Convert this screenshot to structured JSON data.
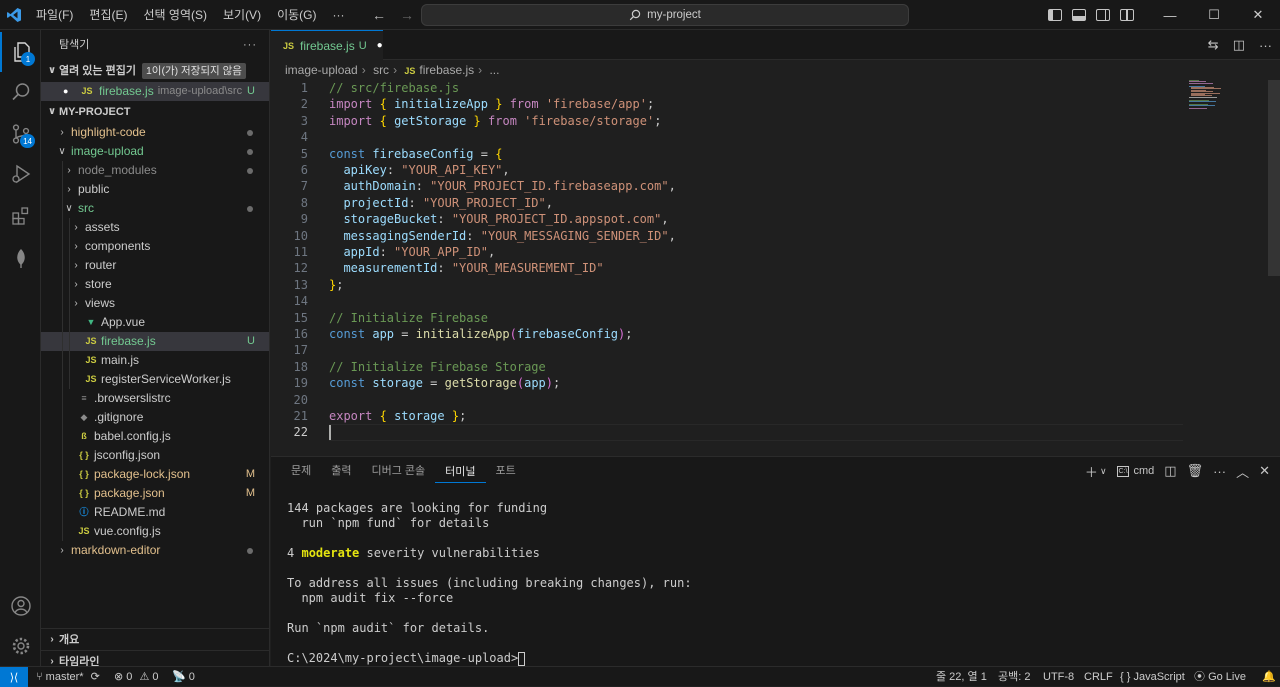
{
  "titlebar": {
    "menu": [
      "파일(F)",
      "편집(E)",
      "선택 영역(S)",
      "보기(V)",
      "이동(G)",
      "···"
    ],
    "search_text": "my-project"
  },
  "activity": {
    "explorer_badge": "1",
    "scm_badge": "14"
  },
  "sidebar": {
    "title": "탐색기",
    "open_editors_label": "열려 있는 편집기",
    "unsaved_tooltip": "1이(가) 저장되지 않음",
    "open_file_name": "firebase.js",
    "open_file_path": "image-upload\\src",
    "open_file_status": "U",
    "project_label": "MY-PROJECT",
    "tree": [
      {
        "label": "highlight-code",
        "kind": "folder",
        "depth": 0,
        "dot": true,
        "color": "modified"
      },
      {
        "label": "image-upload",
        "kind": "folder-open",
        "depth": 0,
        "dot": true,
        "color": "untracked"
      },
      {
        "label": "node_modules",
        "kind": "folder",
        "depth": 1,
        "dot": true,
        "color": "dim"
      },
      {
        "label": "public",
        "kind": "folder",
        "depth": 1,
        "dot": false,
        "color": "normal"
      },
      {
        "label": "src",
        "kind": "folder-open",
        "depth": 1,
        "dot": true,
        "color": "untracked"
      },
      {
        "label": "assets",
        "kind": "folder",
        "depth": 2,
        "dot": false,
        "color": "normal"
      },
      {
        "label": "components",
        "kind": "folder",
        "depth": 2,
        "dot": false,
        "color": "normal"
      },
      {
        "label": "router",
        "kind": "folder",
        "depth": 2,
        "dot": false,
        "color": "normal"
      },
      {
        "label": "store",
        "kind": "folder",
        "depth": 2,
        "dot": false,
        "color": "normal"
      },
      {
        "label": "views",
        "kind": "folder",
        "depth": 2,
        "dot": false,
        "color": "normal"
      },
      {
        "label": "App.vue",
        "kind": "vue",
        "depth": 2,
        "dot": false,
        "color": "normal"
      },
      {
        "label": "firebase.js",
        "kind": "js",
        "depth": 2,
        "status": "U",
        "color": "untracked",
        "selected": true
      },
      {
        "label": "main.js",
        "kind": "js",
        "depth": 2,
        "color": "normal"
      },
      {
        "label": "registerServiceWorker.js",
        "kind": "js",
        "depth": 2,
        "color": "normal"
      },
      {
        "label": ".browserslistrc",
        "kind": "plain",
        "depth": 1,
        "color": "normal"
      },
      {
        "label": ".gitignore",
        "kind": "git",
        "depth": 1,
        "color": "normal"
      },
      {
        "label": "babel.config.js",
        "kind": "babel",
        "depth": 1,
        "color": "normal"
      },
      {
        "label": "jsconfig.json",
        "kind": "json",
        "depth": 1,
        "color": "normal"
      },
      {
        "label": "package-lock.json",
        "kind": "json",
        "depth": 1,
        "status": "M",
        "color": "modified"
      },
      {
        "label": "package.json",
        "kind": "json",
        "depth": 1,
        "status": "M",
        "color": "modified"
      },
      {
        "label": "README.md",
        "kind": "info",
        "depth": 1,
        "color": "normal"
      },
      {
        "label": "vue.config.js",
        "kind": "js",
        "depth": 1,
        "color": "normal"
      },
      {
        "label": "markdown-editor",
        "kind": "folder",
        "depth": 0,
        "dot": true,
        "color": "modified"
      }
    ],
    "outline_label": "개요",
    "timeline_label": "타임라인"
  },
  "editor": {
    "tab_name": "firebase.js",
    "tab_status": "U",
    "breadcrumb": [
      "image-upload",
      "src",
      "firebase.js",
      "..."
    ],
    "lines": [
      [
        [
          "c",
          "// src/firebase.js"
        ]
      ],
      [
        [
          "kc",
          "import"
        ],
        [
          "t",
          " "
        ],
        [
          "p2",
          "{"
        ],
        [
          "t",
          " "
        ],
        [
          "v",
          "initializeApp"
        ],
        [
          "t",
          " "
        ],
        [
          "p2",
          "}"
        ],
        [
          "t",
          " "
        ],
        [
          "kc",
          "from"
        ],
        [
          "t",
          " "
        ],
        [
          "s",
          "'firebase/app'"
        ],
        [
          "t",
          ";"
        ]
      ],
      [
        [
          "kc",
          "import"
        ],
        [
          "t",
          " "
        ],
        [
          "p2",
          "{"
        ],
        [
          "t",
          " "
        ],
        [
          "v",
          "getStorage"
        ],
        [
          "t",
          " "
        ],
        [
          "p2",
          "}"
        ],
        [
          "t",
          " "
        ],
        [
          "kc",
          "from"
        ],
        [
          "t",
          " "
        ],
        [
          "s",
          "'firebase/storage'"
        ],
        [
          "t",
          ";"
        ]
      ],
      [],
      [
        [
          "k",
          "const"
        ],
        [
          "t",
          " "
        ],
        [
          "v",
          "firebaseConfig"
        ],
        [
          "t",
          " = "
        ],
        [
          "p2",
          "{"
        ]
      ],
      [
        [
          "t",
          "  "
        ],
        [
          "v",
          "apiKey"
        ],
        [
          "t",
          ": "
        ],
        [
          "s",
          "\"YOUR_API_KEY\""
        ],
        [
          "t",
          ","
        ]
      ],
      [
        [
          "t",
          "  "
        ],
        [
          "v",
          "authDomain"
        ],
        [
          "t",
          ": "
        ],
        [
          "s",
          "\"YOUR_PROJECT_ID.firebaseapp.com\""
        ],
        [
          "t",
          ","
        ]
      ],
      [
        [
          "t",
          "  "
        ],
        [
          "v",
          "projectId"
        ],
        [
          "t",
          ": "
        ],
        [
          "s",
          "\"YOUR_PROJECT_ID\""
        ],
        [
          "t",
          ","
        ]
      ],
      [
        [
          "t",
          "  "
        ],
        [
          "v",
          "storageBucket"
        ],
        [
          "t",
          ": "
        ],
        [
          "s",
          "\"YOUR_PROJECT_ID.appspot.com\""
        ],
        [
          "t",
          ","
        ]
      ],
      [
        [
          "t",
          "  "
        ],
        [
          "v",
          "messagingSenderId"
        ],
        [
          "t",
          ": "
        ],
        [
          "s",
          "\"YOUR_MESSAGING_SENDER_ID\""
        ],
        [
          "t",
          ","
        ]
      ],
      [
        [
          "t",
          "  "
        ],
        [
          "v",
          "appId"
        ],
        [
          "t",
          ": "
        ],
        [
          "s",
          "\"YOUR_APP_ID\""
        ],
        [
          "t",
          ","
        ]
      ],
      [
        [
          "t",
          "  "
        ],
        [
          "v",
          "measurementId"
        ],
        [
          "t",
          ": "
        ],
        [
          "s",
          "\"YOUR_MEASUREMENT_ID\""
        ]
      ],
      [
        [
          "p2",
          "}"
        ],
        [
          "t",
          ";"
        ]
      ],
      [],
      [
        [
          "c",
          "// Initialize Firebase"
        ]
      ],
      [
        [
          "k",
          "const"
        ],
        [
          "t",
          " "
        ],
        [
          "v",
          "app"
        ],
        [
          "t",
          " = "
        ],
        [
          "f",
          "initializeApp"
        ],
        [
          "p",
          "("
        ],
        [
          "v",
          "firebaseConfig"
        ],
        [
          "p",
          ")"
        ],
        [
          "t",
          ";"
        ]
      ],
      [],
      [
        [
          "c",
          "// Initialize Firebase Storage"
        ]
      ],
      [
        [
          "k",
          "const"
        ],
        [
          "t",
          " "
        ],
        [
          "v",
          "storage"
        ],
        [
          "t",
          " = "
        ],
        [
          "f",
          "getStorage"
        ],
        [
          "p",
          "("
        ],
        [
          "v",
          "app"
        ],
        [
          "p",
          ")"
        ],
        [
          "t",
          ";"
        ]
      ],
      [],
      [
        [
          "kc",
          "export"
        ],
        [
          "t",
          " "
        ],
        [
          "p2",
          "{"
        ],
        [
          "t",
          " "
        ],
        [
          "v",
          "storage"
        ],
        [
          "t",
          " "
        ],
        [
          "p2",
          "}"
        ],
        [
          "t",
          ";"
        ]
      ],
      []
    ],
    "current_line": 22
  },
  "panel": {
    "tabs": [
      "문제",
      "출력",
      "디버그 콘솔",
      "터미널",
      "포트"
    ],
    "active_tab": "터미널",
    "terminal_profile": "cmd",
    "terminal_lines": [
      "144 packages are looking for funding",
      "  run `npm fund` for details",
      "",
      "__VULN__",
      "",
      "To address all issues (including breaking changes), run:",
      "  npm audit fix --force",
      "",
      "Run `npm audit` for details.",
      "",
      "__PROMPT__"
    ],
    "vuln_count": "4",
    "vuln_word": "moderate",
    "vuln_rest": " severity vulnerabilities",
    "prompt": "C:\\2024\\my-project\\image-upload>"
  },
  "statusbar": {
    "branch": "master*",
    "errors": "0",
    "warnings": "0",
    "ports": "0",
    "position": "줄 22, 열 1",
    "spaces": "공백: 2",
    "encoding": "UTF-8",
    "eol": "CRLF",
    "language": "JavaScript",
    "golive": "Go Live"
  }
}
